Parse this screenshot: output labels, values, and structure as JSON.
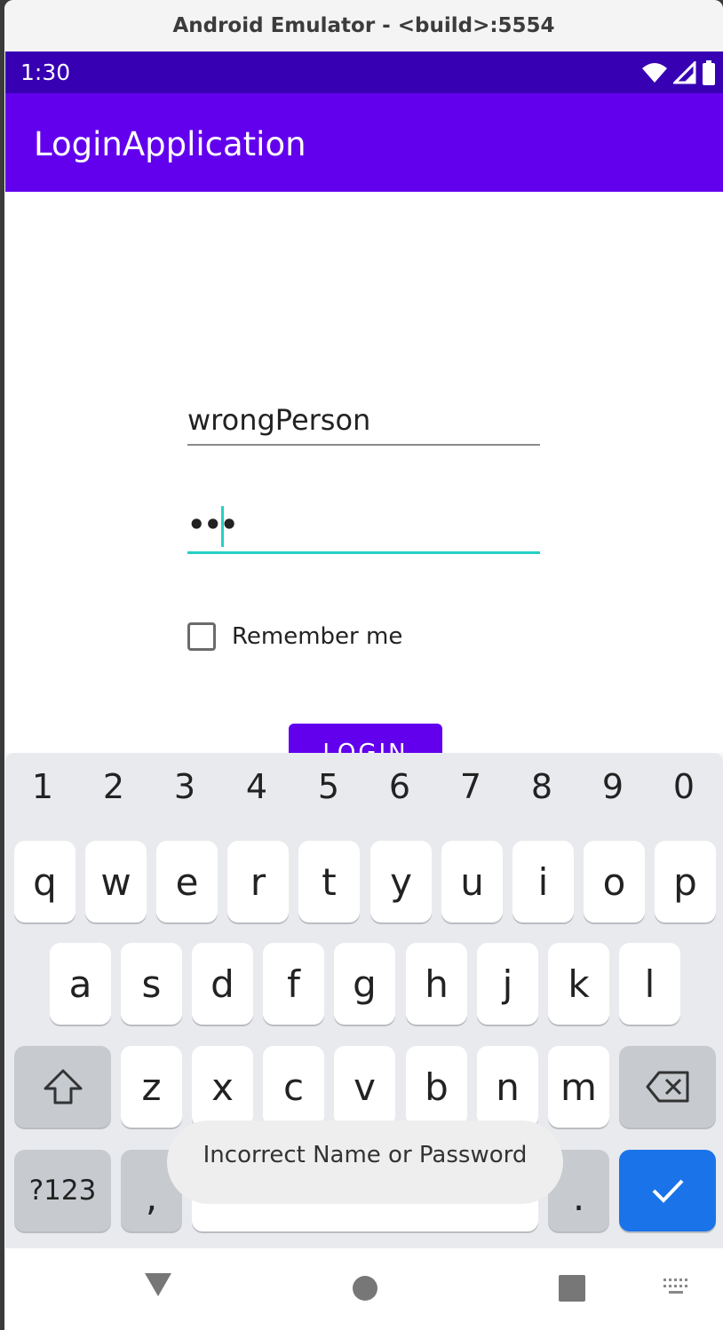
{
  "window": {
    "title": "Android Emulator - <build>:5554"
  },
  "status_bar": {
    "time": "1:30",
    "icons": [
      "wifi-icon",
      "signal-icon",
      "battery-icon"
    ]
  },
  "app_bar": {
    "title": "LoginApplication"
  },
  "form": {
    "username_value": "wrongPerson",
    "password_value": "•••",
    "remember_label": "Remember me",
    "remember_checked": false,
    "login_label": "LOGIN"
  },
  "keyboard": {
    "numbers": [
      "1",
      "2",
      "3",
      "4",
      "5",
      "6",
      "7",
      "8",
      "9",
      "0"
    ],
    "row1": [
      "q",
      "w",
      "e",
      "r",
      "t",
      "y",
      "u",
      "i",
      "o",
      "p"
    ],
    "row2": [
      "a",
      "s",
      "d",
      "f",
      "g",
      "h",
      "j",
      "k",
      "l"
    ],
    "row3": [
      "z",
      "x",
      "c",
      "v",
      "b",
      "n",
      "m"
    ],
    "symbols_label": "?123",
    "comma": ",",
    "period": ".",
    "shift_icon": "shift-icon",
    "backspace_icon": "backspace-icon",
    "enter_icon": "checkmark-icon"
  },
  "toast": {
    "message": "Incorrect Name or Password"
  },
  "nav_bar": {
    "icons": [
      "back-triangle-icon",
      "home-circle-icon",
      "recents-square-icon",
      "keyboard-switch-icon"
    ]
  },
  "colors": {
    "primary": "#6200ee",
    "primary_dark": "#3700b3",
    "accent": "#26d0c4",
    "enter_key": "#1a73e8"
  }
}
